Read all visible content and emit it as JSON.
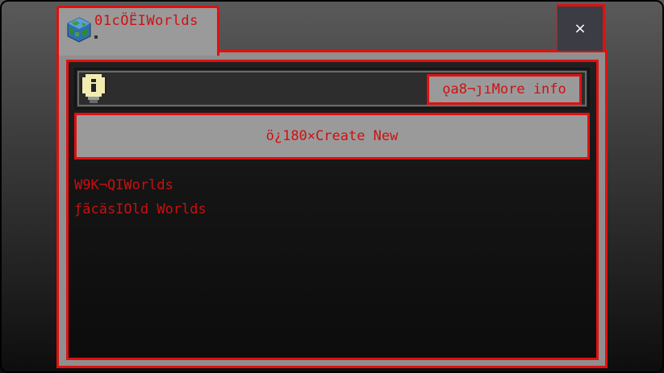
{
  "tab": {
    "title": "01cÖËIWorlds",
    "icon": "world-globe-icon"
  },
  "close_button": {
    "label": "×",
    "icon": "close-icon"
  },
  "info_bar": {
    "icon": "lightbulb-icon",
    "more_info_label": "ǫa8¬ȷıMore info"
  },
  "create_new": {
    "label": "ö¿180×Create New"
  },
  "world_list": {
    "items": [
      {
        "label": "W9K¬QIWorlds"
      },
      {
        "label": "ƒãcäsIOld Worlds"
      }
    ]
  },
  "colors": {
    "accent": "#e01010",
    "text": "#d01010",
    "panel": "#9a9a9a",
    "dark": "#151515"
  }
}
